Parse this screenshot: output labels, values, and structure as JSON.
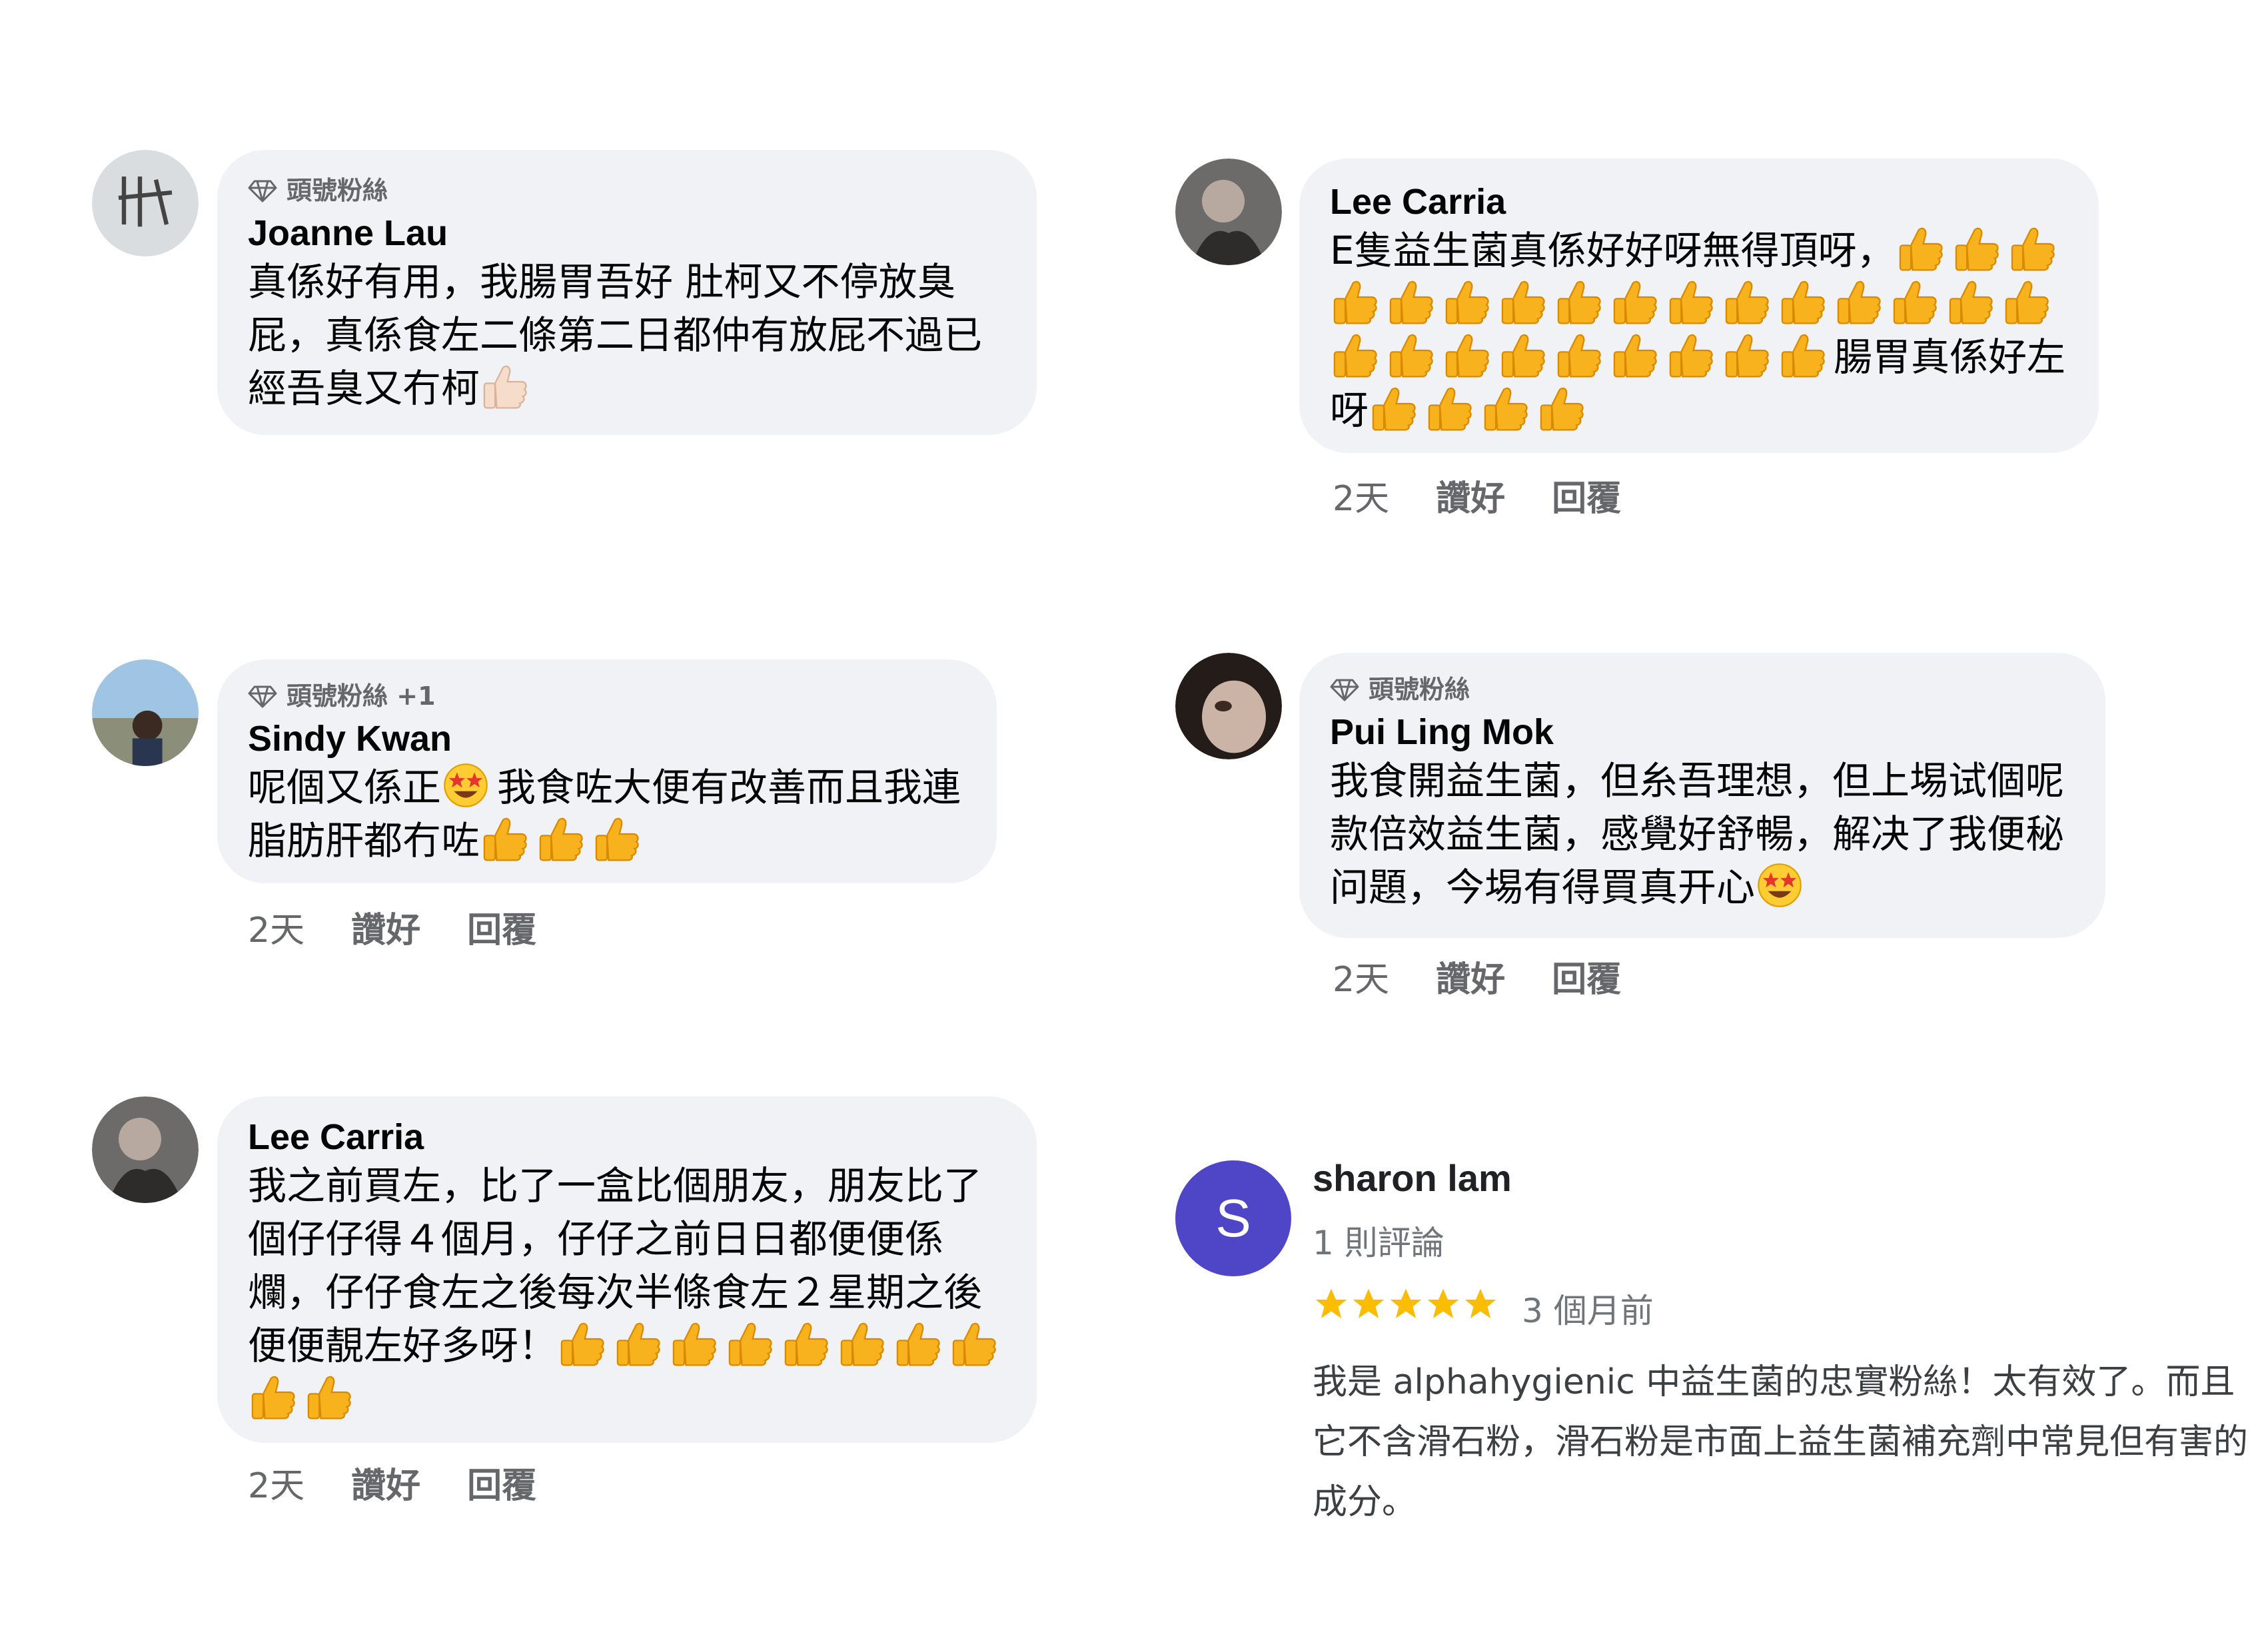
{
  "colors": {
    "bubble": "#f0f2f5",
    "meta": "#65676b",
    "google_avatar": "#4f46c7",
    "star": "#fbbc04",
    "thumb": "#f7b21e"
  },
  "comments": [
    {
      "id": "c1",
      "badge": "頭號粉絲",
      "name": "Joanne Lau",
      "text": "真係好有用，我腸胃吾好 肚柯又不停放臭屁，真係食左二條第二日都仲有放屁不過已經吾臭又冇柯",
      "emoji": "thumbs-up-light-icon"
    },
    {
      "id": "c2",
      "badge": "",
      "name": "Lee Carria",
      "text_a": "E隻益生菌真係好好呀無得頂呀，",
      "text_b": "腸胃真係好左呀",
      "emoji": "thumbs-up-icon",
      "meta": {
        "time": "2天",
        "like": "讚好",
        "reply": "回覆"
      }
    },
    {
      "id": "c3",
      "badge": "頭號粉絲 +1",
      "name": "Sindy Kwan",
      "text_a": "呢個又係正",
      "text_b": "我食咗大便有改善而且我連脂肪肝都冇咗",
      "emoji": "star-struck-icon",
      "meta": {
        "time": "2天",
        "like": "讚好",
        "reply": "回覆"
      }
    },
    {
      "id": "c4",
      "badge": "頭號粉絲",
      "name": "Pui Ling Mok",
      "text": "我食開益生菌，但糸吾理想，但上埸试個呢款倍效益生菌，感覺好舒暢，解决了我便秘问題，今埸有得買真开心",
      "emoji": "star-struck-icon",
      "meta": {
        "time": "2天",
        "like": "讚好",
        "reply": "回覆"
      }
    },
    {
      "id": "c5",
      "badge": "",
      "name": "Lee Carria",
      "text": "我之前買左，比了一盒比個朋友，朋友比了個仔仔得４個月，仔仔之前日日都便便係爛，仔仔食左之後每次半條食左２星期之後便便靚左好多呀！",
      "emoji": "thumbs-up-icon",
      "meta": {
        "time": "2天",
        "like": "讚好",
        "reply": "回覆"
      }
    }
  ],
  "google_review": {
    "avatar_letter": "S",
    "name": "sharon lam",
    "review_count": "1 則評論",
    "stars": 5,
    "time": "3 個月前",
    "text": "我是 alphahygienic 中益生菌的忠實粉絲！太有效了。而且它不含滑石粉，滑石粉是市面上益生菌補充劑中常見但有害的成分。"
  }
}
